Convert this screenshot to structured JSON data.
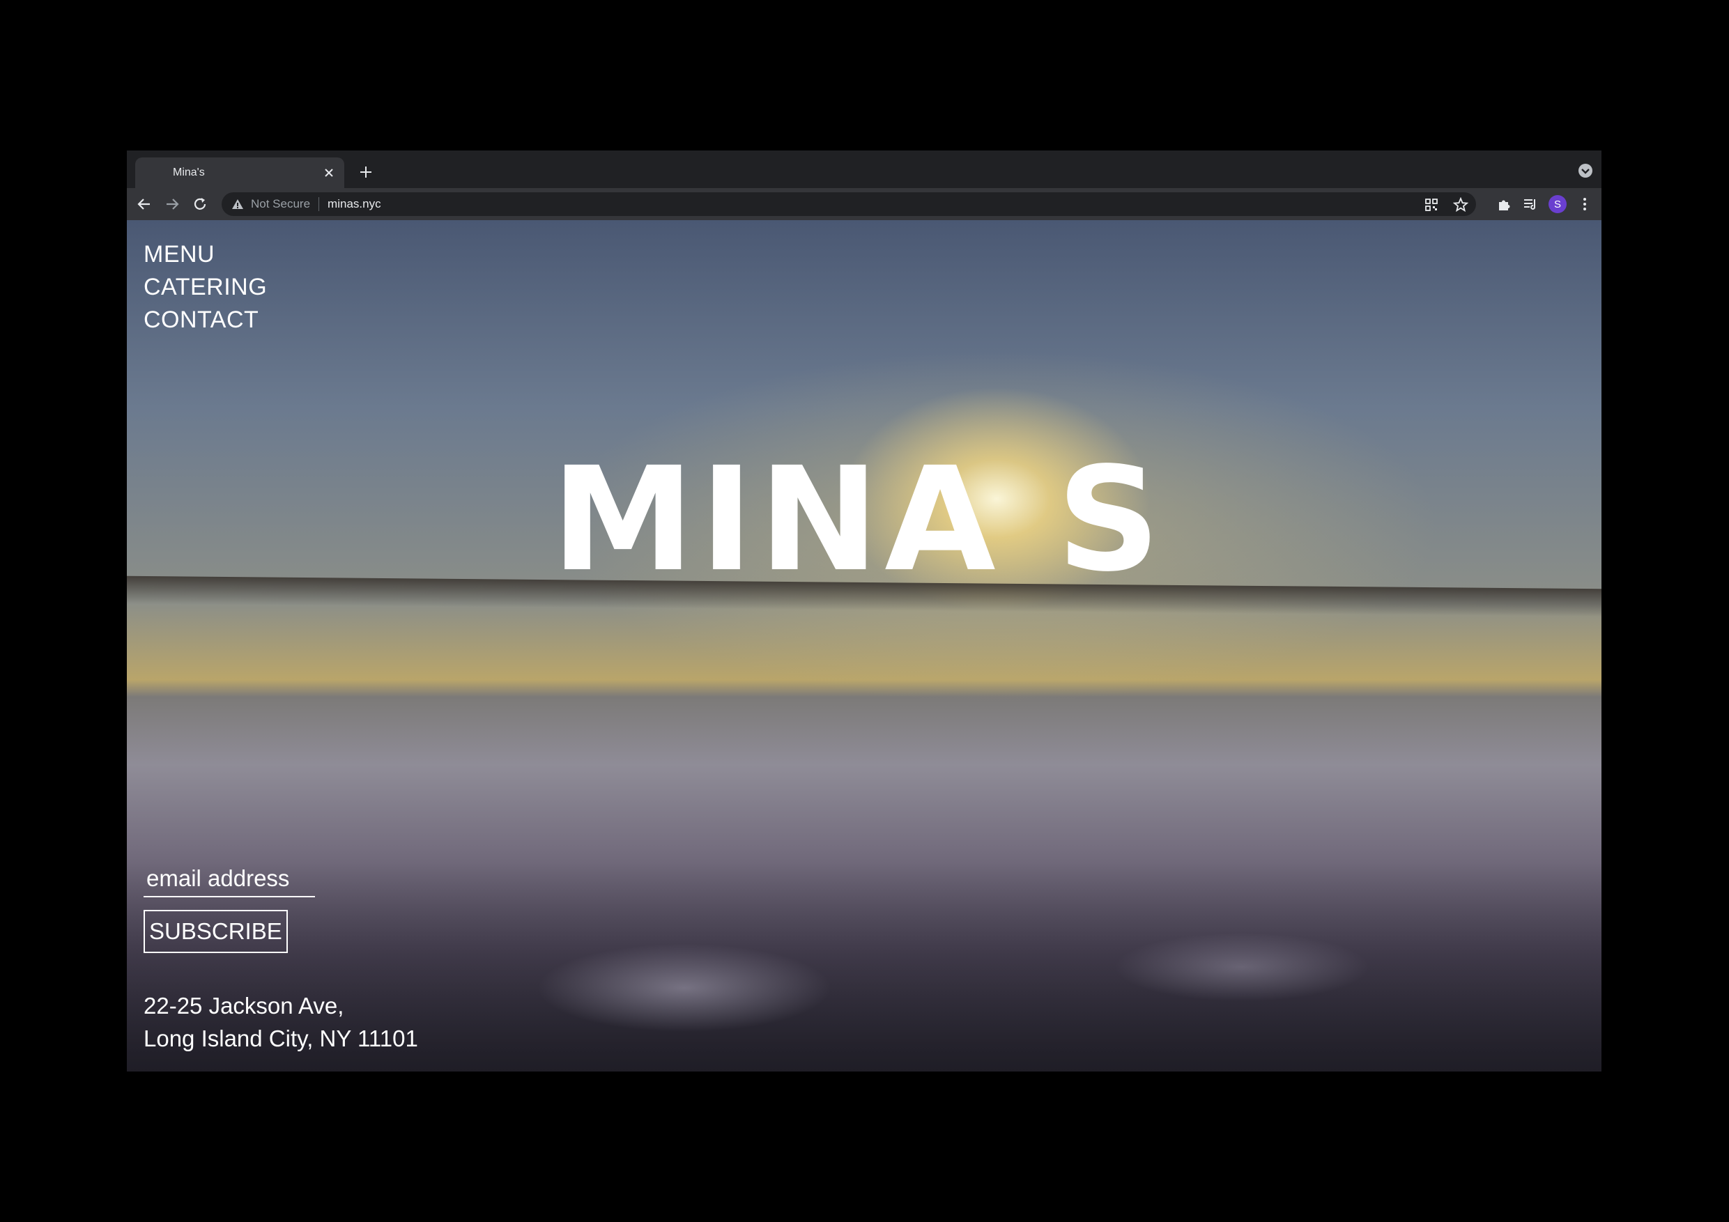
{
  "browser": {
    "tab_title": "Mina's",
    "security_label": "Not Secure",
    "url": "minas.nyc",
    "profile_initial": "S",
    "accent_profile": "#6a3fcf"
  },
  "page": {
    "nav": [
      "MENU",
      "CATERING",
      "CONTACT"
    ],
    "logo": "MINA S",
    "email_placeholder": "email address",
    "subscribe_label": "SUBSCRIBE",
    "address_line1": "22-25 Jackson Ave,",
    "address_line2": "Long Island City, NY 11101"
  },
  "icons": {
    "favicon": "moon-icon",
    "close": "close-icon",
    "newtab": "plus-icon",
    "back": "back-arrow-icon",
    "forward": "forward-arrow-icon",
    "reload": "reload-icon",
    "warning": "warning-icon",
    "qr": "qr-code-icon",
    "bookmark": "star-icon",
    "extensions": "puzzle-icon",
    "reading_list": "reading-list-icon",
    "menu": "kebab-menu-icon",
    "tab_search": "tab-search-icon"
  }
}
